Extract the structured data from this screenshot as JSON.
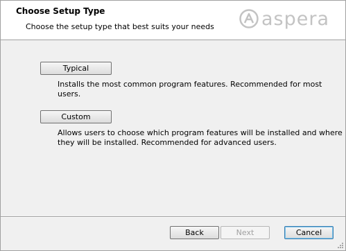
{
  "header": {
    "title": "Choose Setup Type",
    "subtitle": "Choose the setup type that best suits your needs",
    "logo_text": "aspera"
  },
  "options": [
    {
      "button_label": "Typical",
      "description": "Installs the most common program features. Recommended for most users."
    },
    {
      "button_label": "Custom",
      "description_line1": "Allows users to choose which program features will be installed and where",
      "description_line2": "they will be installed. Recommended for advanced users."
    }
  ],
  "footer": {
    "back_label": "Back",
    "next_label": "Next",
    "cancel_label": "Cancel"
  },
  "colors": {
    "logo": "#c3c3c3",
    "header_bg": "#ffffff",
    "dialog_bg": "#f0f0f0"
  }
}
